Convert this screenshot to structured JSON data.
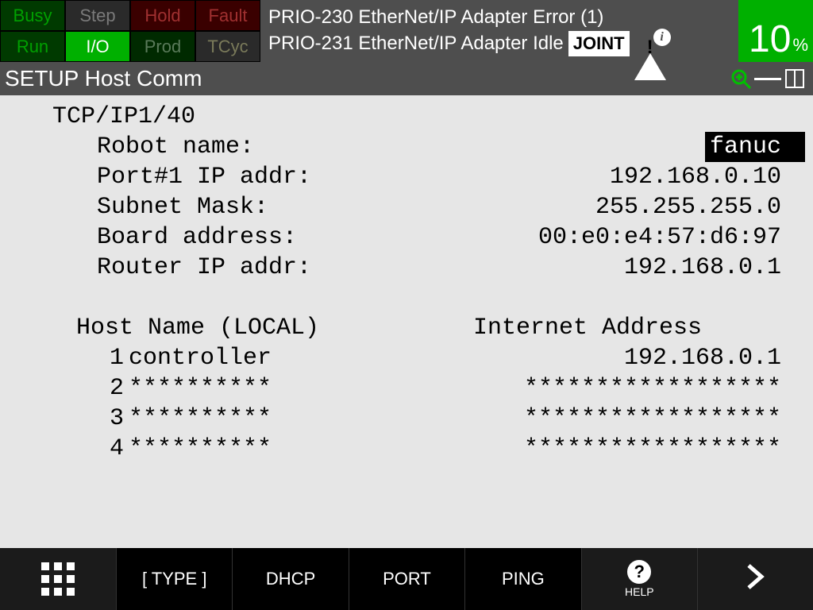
{
  "status": {
    "busy": "Busy",
    "step": "Step",
    "hold": "Hold",
    "fault": "Fault",
    "run": "Run",
    "io": "I/O",
    "prod": "Prod",
    "tcyc": "TCyc"
  },
  "alarms": {
    "line1": "PRIO-230 EtherNet/IP Adapter Error (1)",
    "line2": "PRIO-231 EtherNet/IP Adapter Idle",
    "mode": "JOINT"
  },
  "override": {
    "value": "10",
    "unit": "%"
  },
  "title": "SETUP Host Comm",
  "page": {
    "section": "TCP/IP",
    "counter": "1/40",
    "fields": {
      "robot_name_label": "Robot name:",
      "robot_name_value": "fanuc",
      "port1_ip_label": "Port#1 IP addr:",
      "port1_ip_value": "192.168.0.10",
      "subnet_label": "Subnet Mask:",
      "subnet_value": "255.255.255.0",
      "board_addr_label": "Board address:",
      "board_addr_value": "00:e0:e4:57:d6:97",
      "router_ip_label": "Router IP addr:",
      "router_ip_value": "192.168.0.1"
    },
    "table": {
      "col1_header": "Host Name (LOCAL)",
      "col2_header": "Internet Address",
      "rows": [
        {
          "idx": "1",
          "name": "controller",
          "addr": "192.168.0.1"
        },
        {
          "idx": "2",
          "name": "**********",
          "addr": "******************"
        },
        {
          "idx": "3",
          "name": "**********",
          "addr": "******************"
        },
        {
          "idx": "4",
          "name": "**********",
          "addr": "******************"
        }
      ]
    }
  },
  "softkeys": {
    "type": "[ TYPE ]",
    "dhcp": "DHCP",
    "port": "PORT",
    "ping": "PING",
    "help": "HELP"
  }
}
